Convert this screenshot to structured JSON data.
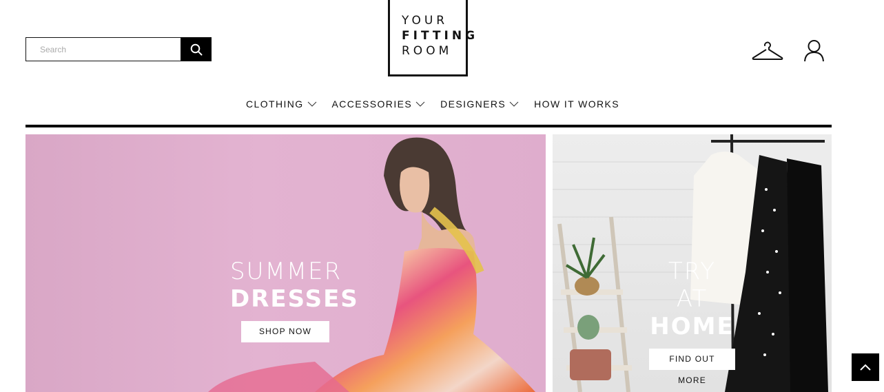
{
  "header": {
    "search_placeholder": "Search",
    "logo": {
      "line1": "YOUR",
      "line2": "FITTING",
      "line3": "ROOM"
    }
  },
  "nav": {
    "items": [
      {
        "label": "CLOTHING",
        "has_dropdown": true
      },
      {
        "label": "ACCESSORIES",
        "has_dropdown": true
      },
      {
        "label": "DESIGNERS",
        "has_dropdown": true
      },
      {
        "label": "HOW IT WORKS",
        "has_dropdown": false
      }
    ]
  },
  "hero": {
    "left": {
      "line1": "SUMMER",
      "line2": "DRESSES",
      "button": "SHOP NOW"
    },
    "right": {
      "line1": "TRY AT",
      "line2": "HOME",
      "button": "FIND OUT MORE"
    }
  },
  "icons": {
    "search": "search-icon",
    "wishlist": "hanger-icon",
    "account": "user-icon",
    "scroll_top": "chevron-up-icon"
  },
  "colors": {
    "brand": "#000000",
    "left_banner": "#dfadcd",
    "right_banner": "#e8e8e8"
  }
}
